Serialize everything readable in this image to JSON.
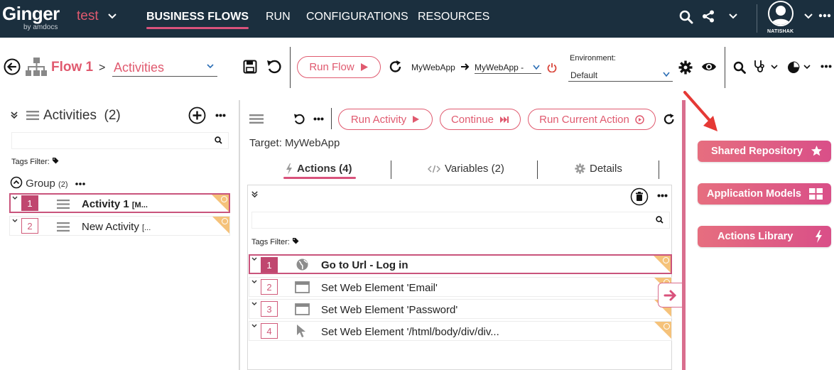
{
  "topbar": {
    "logo_name": "Ginger",
    "logo_by": "by amdocs",
    "solution": "test",
    "nav": [
      "BUSINESS FLOWS",
      "RUN",
      "CONFIGURATIONS",
      "RESOURCES"
    ],
    "active_nav": "BUSINESS FLOWS",
    "user": "NATISHAK",
    "colors": {
      "background": "#1b2f3e",
      "accent": "#d9527c"
    }
  },
  "toolbar": {
    "flow_name": "Flow 1",
    "breadcrumb_separator": ">",
    "flow_page": "Activities",
    "run_flow": "Run Flow",
    "app_name": "MyWebApp",
    "app_target": "MyWebApp -",
    "env_label": "Environment:",
    "env_value": "Default"
  },
  "activities_panel": {
    "title": "Activities",
    "count": "(2)",
    "search_placeholder": "",
    "tags_filter": "Tags Filter:",
    "group": {
      "name": "Group",
      "count": "(2)"
    },
    "items": [
      {
        "num": "1",
        "label": "Activity 1",
        "suffix": "[M...",
        "selected": true
      },
      {
        "num": "2",
        "label": "New Activity",
        "suffix": "[...",
        "selected": false
      }
    ]
  },
  "activity_toolbar": {
    "run_activity": "Run Activity",
    "continue": "Continue",
    "run_current_action": "Run Current Action"
  },
  "activity_details": {
    "target": "Target: MyWebApp",
    "tabs": [
      {
        "label": "Actions (4)",
        "icon": "lightning-icon",
        "active": true
      },
      {
        "label": "Variables (2)",
        "icon": "code-icon",
        "active": false
      },
      {
        "label": "Details",
        "icon": "gear-icon",
        "active": false
      }
    ],
    "tags_filter": "Tags Filter:",
    "actions": [
      {
        "num": "1",
        "label": "Go to Url - Log in",
        "icon": "globe-icon",
        "selected": true
      },
      {
        "num": "2",
        "label": "Set Web Element 'Email'",
        "icon": "window-icon",
        "selected": false
      },
      {
        "num": "3",
        "label": "Set Web Element 'Password'",
        "icon": "window-icon",
        "selected": false
      },
      {
        "num": "4",
        "label": "Set Web Element '/html/body/div/div...",
        "icon": "cursor-icon",
        "selected": false
      }
    ]
  },
  "side_drawer": {
    "buttons": [
      {
        "label": "Shared Repository",
        "icon": "star-icon"
      },
      {
        "label": "Application Models",
        "icon": "grid-icon"
      },
      {
        "label": "Actions Library",
        "icon": "lightning-icon"
      }
    ]
  }
}
